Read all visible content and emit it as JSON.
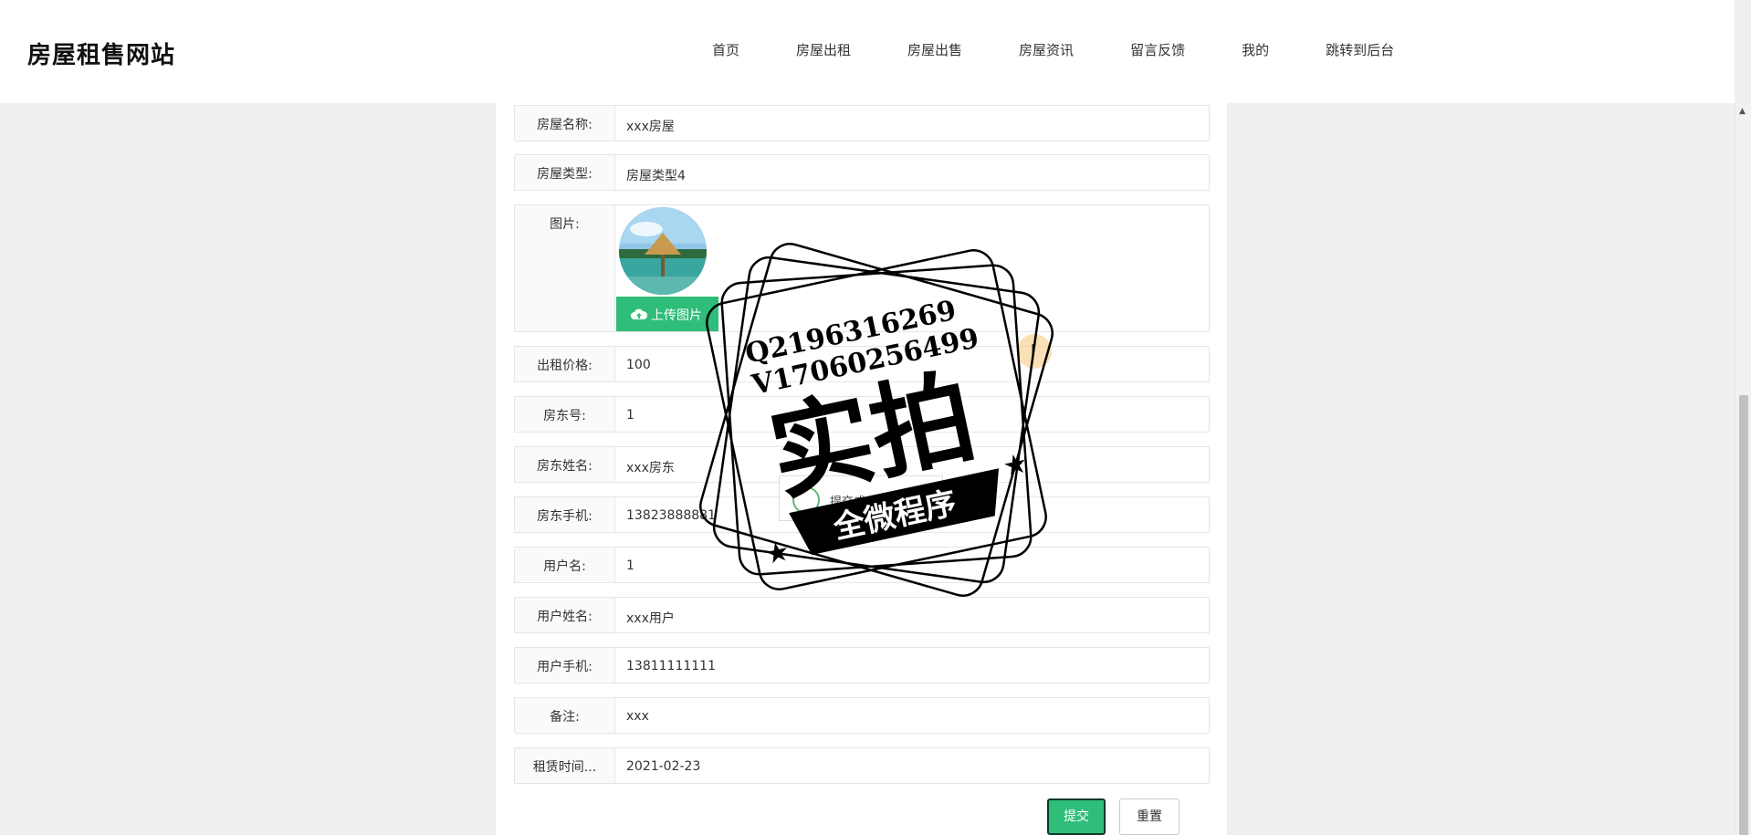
{
  "header": {
    "brand": "房屋租售网站",
    "nav": [
      "首页",
      "房屋出租",
      "房屋出售",
      "房屋资讯",
      "留言反馈",
      "我的",
      "跳转到后台"
    ]
  },
  "form": {
    "house_name": {
      "label": "房屋名称:",
      "value": "xxx房屋"
    },
    "house_type": {
      "label": "房屋类型:",
      "value": "房屋类型4"
    },
    "image": {
      "label": "图片:",
      "upload_label": "上传图片"
    },
    "rent_price": {
      "label": "出租价格:",
      "value": "100"
    },
    "landlord_no": {
      "label": "房东号:",
      "value": "1"
    },
    "landlord_name": {
      "label": "房东姓名:",
      "value": "xxx房东"
    },
    "landlord_phone": {
      "label": "房东手机:",
      "value": "13823888881"
    },
    "username": {
      "label": "用户名:",
      "value": "1"
    },
    "user_fullname": {
      "label": "用户姓名:",
      "value": "xxx用户"
    },
    "user_phone": {
      "label": "用户手机:",
      "value": "13811111111"
    },
    "remark": {
      "label": "备注:",
      "value": "xxx"
    },
    "rent_time": {
      "label": "租赁时间...",
      "value": "2021-02-23"
    },
    "submit_label": "提交",
    "reset_label": "重置"
  },
  "toast": {
    "message": "提交成功"
  },
  "watermark": {
    "line1": "Q2196316269",
    "line2": "V17060256499",
    "big": "实拍",
    "banner": "全微程序"
  },
  "colors": {
    "accent": "#2fbd7a",
    "background": "#efefef",
    "header_bg": "#ffffff"
  },
  "icons": {
    "upload": "cloud-upload-icon",
    "success": "check-circle-icon"
  }
}
